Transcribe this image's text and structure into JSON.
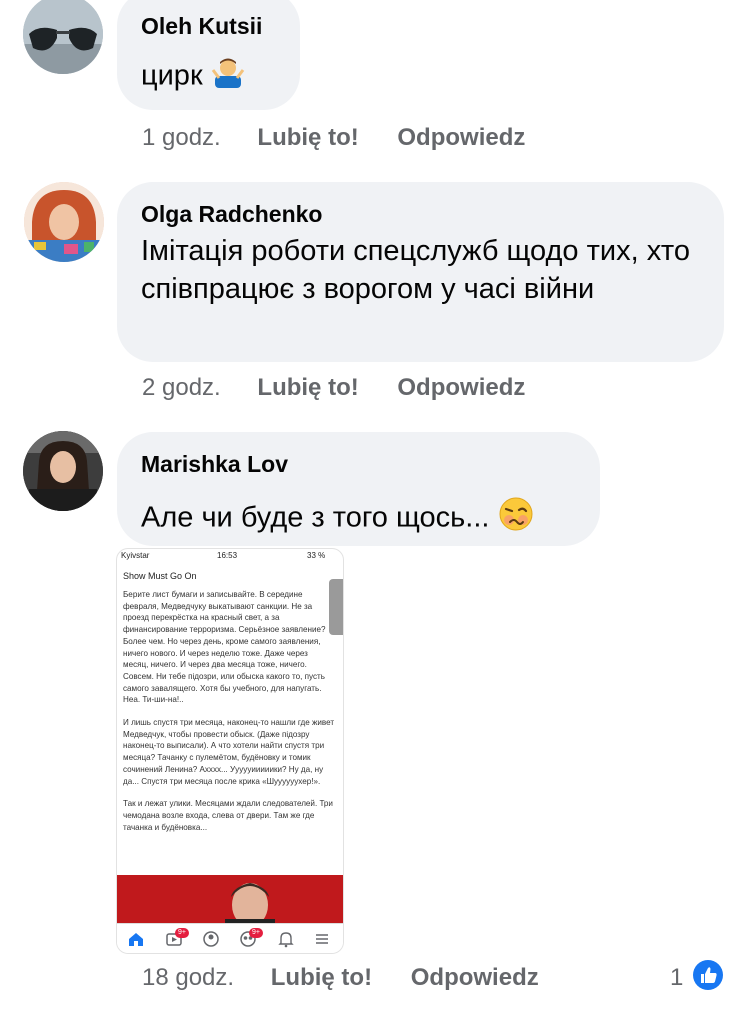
{
  "comments": [
    {
      "author": "Oleh Kutsii",
      "text": "цирк",
      "emoji": "man-shrugging-emoji",
      "time": "1 godz.",
      "like_label": "Lubię to!",
      "reply_label": "Odpowiedz"
    },
    {
      "author": "Olga Radchenko",
      "text": "Імітація роботи спецслужб щодо тих, хто співпрацює з ворогом у часі війни",
      "time": "2 godz.",
      "like_label": "Lubię to!",
      "reply_label": "Odpowiedz"
    },
    {
      "author": "Marishka Lov",
      "text": "Але чи буде з того щось...",
      "emoji": "woozy-face-emoji",
      "time": "18 godz.",
      "like_label": "Lubię to!",
      "reply_label": "Odpowiedz",
      "reaction_count": "1",
      "attachment": {
        "status_carrier": "Kyivstar",
        "status_time": "16:53",
        "status_battery": "33 %",
        "title": "Show Must Go On",
        "paragraphs": [
          "Берите лист бумаги и записывайте. В середине февраля, Медведчуку выкатывают санкции. Не за проезд перекрёстка на красный свет, а за финансирование терроризма. Серьёзное заявление? Более чем. Но через день, кроме самого заявления, ничего нового. И через неделю тоже. Даже через месяц, ничего. И через два месяца тоже, ничего. Совсем. Ни тебе підозри, или обыска какого то, пусть самого завалящего. Хотя бы учебного, для напугать. Неа. Ти-ши-на!..",
          "И лишь спустя три месяца, наконец-то нашли где живет Медведчук, чтобы провести обыск. (Даже підозру наконец-то выписали). А что хотели найти спустя три месяца? Тачанку с пулемётом, будёновку и томик сочинений Ленина? Ахххх... Уууууииииики? Ну да, ну да... Спустя три месяца после крика «Шуууууухер!».",
          "Так и лежат улики. Месяцами ждали следователей. Три чемодана возле входа, слева от двери. Там же где тачанка и будёновка..."
        ],
        "nav_badge_1": "9+",
        "nav_badge_2": "9+"
      }
    }
  ],
  "colors": {
    "bubble": "#f0f2f5",
    "meta": "#65676b",
    "like_blue": "#1877f2"
  }
}
